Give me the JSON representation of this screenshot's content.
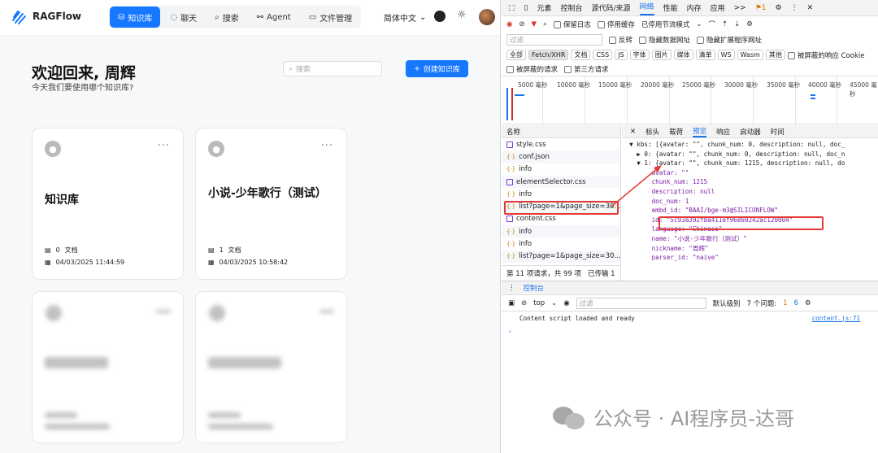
{
  "app": {
    "brand": "RAGFlow",
    "nav": [
      {
        "label": "知识库",
        "icon": "database-icon"
      },
      {
        "label": "聊天",
        "icon": "chat-icon"
      },
      {
        "label": "搜索",
        "icon": "search-icon"
      },
      {
        "label": "Agent",
        "icon": "agent-icon"
      },
      {
        "label": "文件管理",
        "icon": "folder-icon"
      }
    ],
    "language": "简体中文",
    "welcome": "欢迎回来, 周辉",
    "subtitle": "今天我们要使用哪个知识库?",
    "search_placeholder": "搜索",
    "create_label": "创建知识库",
    "cards": [
      {
        "title": "知识库",
        "docs": "0",
        "docs_unit": "文档",
        "date": "04/03/2025 11:44:59"
      },
      {
        "title": "小说-少年歌行（测试）",
        "docs": "1",
        "docs_unit": "文档",
        "date": "04/03/2025 10:58:42"
      }
    ]
  },
  "devtools": {
    "tabs": [
      "元素",
      "控制台",
      "源代码/来源",
      "网络",
      "性能",
      "内存",
      "应用",
      ">>"
    ],
    "issue_count": "1",
    "toolbar": {
      "preserve_log": "保留日志",
      "disable_cache": "停用缓存",
      "throttle": "已停用节流模式"
    },
    "filter_placeholder": "过滤",
    "invert": "反转",
    "hide_data_urls": "隐藏数据网址",
    "hide_ext_urls": "隐藏扩展程序网址",
    "type_chips": [
      "全部",
      "Fetch/XHR",
      "文档",
      "CSS",
      "JS",
      "字体",
      "图片",
      "媒体",
      "清单",
      "WS",
      "Wasm",
      "其他"
    ],
    "blocked_cookies": "被屏蔽的响应 Cookie",
    "blocked_requests": "被屏蔽的请求",
    "third_party": "第三方请求",
    "timeline_labels": [
      "5000 毫秒",
      "10000 毫秒",
      "15000 毫秒",
      "20000 毫秒",
      "25000 毫秒",
      "30000 毫秒",
      "35000 毫秒",
      "40000 毫秒",
      "45000 毫秒"
    ],
    "list_header": "名称",
    "requests": [
      {
        "name": "style.css",
        "type": "css"
      },
      {
        "name": "conf.json",
        "type": "fetch"
      },
      {
        "name": "info",
        "type": "fetch"
      },
      {
        "name": "elementSelector.css",
        "type": "css"
      },
      {
        "name": "info",
        "type": "fetch"
      },
      {
        "name": "list?page=1&page_size=30...",
        "type": "fetch"
      },
      {
        "name": "content.css",
        "type": "css"
      },
      {
        "name": "info",
        "type": "fetch"
      },
      {
        "name": "info",
        "type": "fetch"
      },
      {
        "name": "list?page=1&page_size=30...",
        "type": "fetch"
      }
    ],
    "list_footer": "第 11 项请求，共 99 项",
    "list_footer2": "已传输 1",
    "detail_tabs": [
      "标头",
      "载荷",
      "预览",
      "响应",
      "启动器",
      "时间"
    ],
    "code_lines": [
      "  ▼ kbs: [{avatar: \"\", chunk_num: 0, description: null, doc_",
      "    ▶ 0: {avatar: \"\", chunk_num: 0, description: null, doc_n",
      "    ▼ 1: {avatar: \"\", chunk_num: 1215, description: null, do",
      "        avatar: \"\"",
      "        chunk_num: 1215",
      "        description: null",
      "        doc_num: 1",
      "        embd_id: \"BAAI/bge-m3@SILICONFLOW\"",
      "        id: \"5c93a392f8a411ef96e60242ac120004\"",
      "        language: \"Chinese\"",
      "        name: \"小说-少年歌行（测试）\"",
      "        nickname: \"周辉\"",
      "        parser_id: \"naive\""
    ],
    "console_tab": "控制台",
    "console_context": "top",
    "console_filter": "过滤",
    "console_level": "默认级别",
    "console_issues": "7 个问题:",
    "console_issue_counts": [
      "1",
      "6"
    ],
    "console_message": "Content script loaded and ready",
    "console_source": "content.js:71"
  },
  "watermark": "公众号 · AI程序员-达哥",
  "colors": {
    "accent": "#1677ff",
    "highlight": "#e53935",
    "devtools_accent": "#1a73e8"
  }
}
